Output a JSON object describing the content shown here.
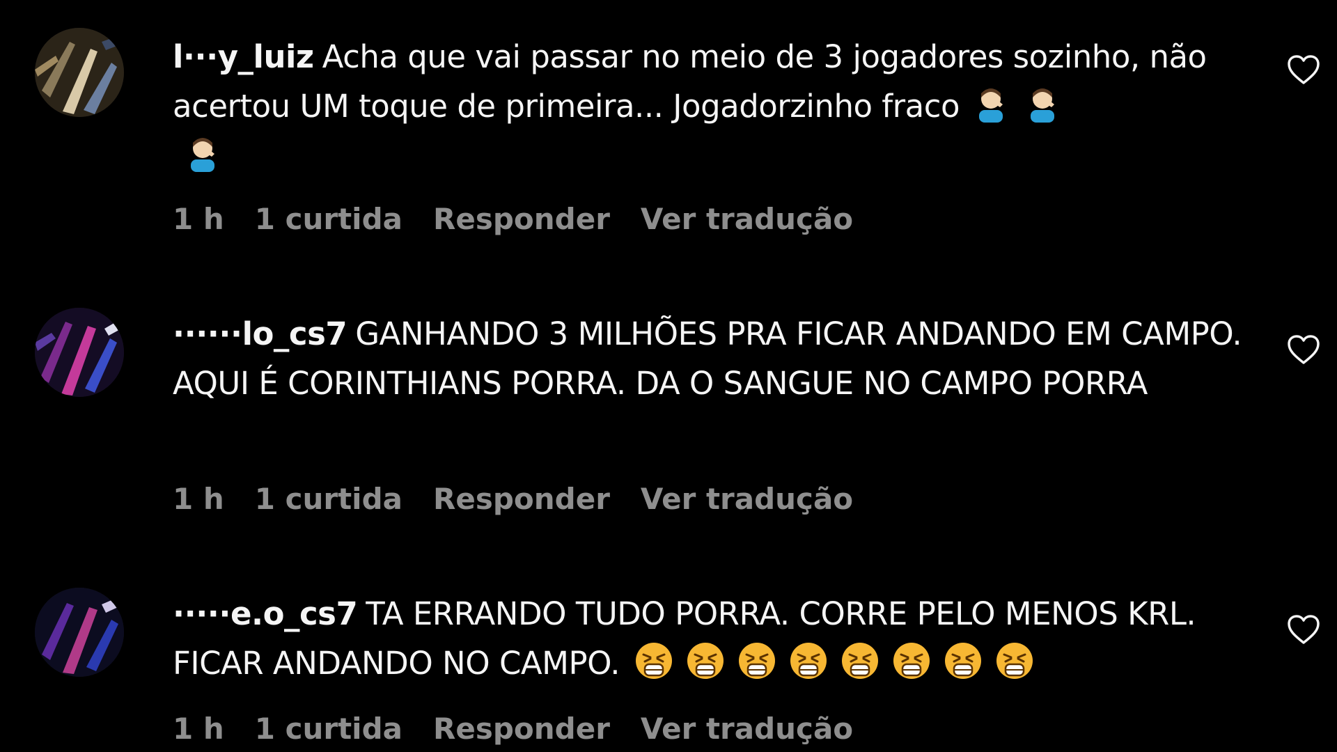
{
  "comments": [
    {
      "username": "l···y_luiz",
      "text": "Acha que vai passar no meio de 3 jogadores sozinho, não acertou UM toque de primeira... Jogadorzinho fraco",
      "emoji": "person-facepalming-emoji",
      "emoji_count": 3,
      "time": "1 h",
      "likes": "1 curtida",
      "reply_label": "Responder",
      "translate_label": "Ver tradução",
      "like_icon": "heart-outline-icon"
    },
    {
      "username": "······lo_cs7",
      "text": "GANHANDO 3 MILHÕES PRA FICAR ANDANDO EM CAMPO. AQUI É CORINTHIANS PORRA. DA O SANGUE NO CAMPO PORRA",
      "time": "1 h",
      "likes": "1 curtida",
      "reply_label": "Responder",
      "translate_label": "Ver tradução",
      "like_icon": "heart-outline-icon"
    },
    {
      "username": "·····e.o_cs7",
      "text": "TA ERRANDO TUDO PORRA. CORRE PELO MENOS KRL. FICAR ANDANDO NO CAMPO.",
      "emoji": "tired-face-emoji",
      "emoji_count": 8,
      "time": "1 h",
      "likes": "1 curtida",
      "reply_label": "Responder",
      "translate_label": "Ver tradução",
      "like_icon": "heart-outline-icon"
    }
  ],
  "colors": {
    "background": "#000000",
    "text": "#f5f5f5",
    "meta": "#8e8e8e"
  }
}
